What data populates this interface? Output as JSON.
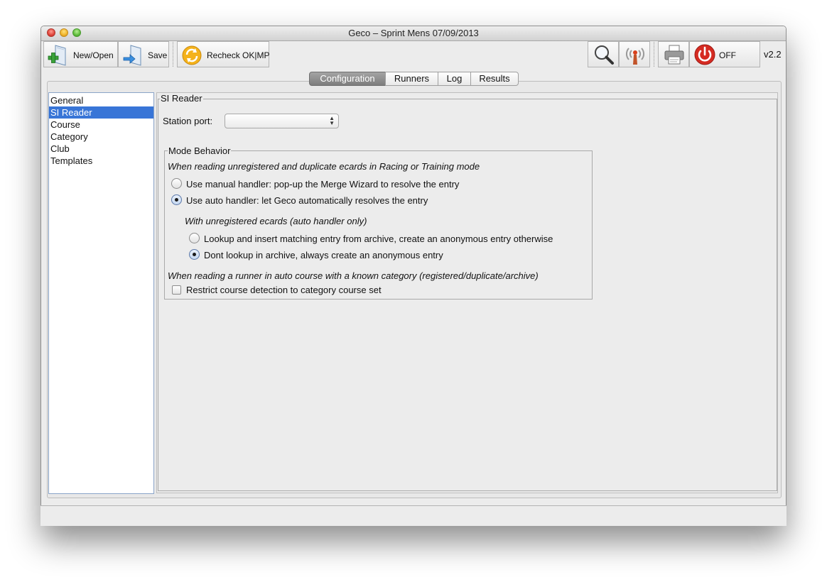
{
  "window": {
    "title": "Geco – Sprint Mens 07/09/2013"
  },
  "toolbar": {
    "new_open_label": "New/Open",
    "save_label": "Save",
    "recheck_label": "Recheck OK|MP",
    "off_label": "OFF",
    "version": "v2.2",
    "icons": [
      "new-file-icon",
      "save-file-icon",
      "recheck-icon",
      "magnifier-icon",
      "antenna-icon",
      "printer-icon",
      "power-icon"
    ]
  },
  "tabs": [
    {
      "label": "Configuration",
      "active": true
    },
    {
      "label": "Runners",
      "active": false
    },
    {
      "label": "Log",
      "active": false
    },
    {
      "label": "Results",
      "active": false
    }
  ],
  "sidebar": {
    "items": [
      {
        "label": "General",
        "selected": false
      },
      {
        "label": "SI Reader",
        "selected": true
      },
      {
        "label": "Course",
        "selected": false
      },
      {
        "label": "Category",
        "selected": false
      },
      {
        "label": "Club",
        "selected": false
      },
      {
        "label": "Templates",
        "selected": false
      }
    ]
  },
  "si_reader": {
    "section_title": "SI Reader",
    "station_port_label": "Station port:",
    "station_port_value": "",
    "mode_behavior": {
      "title": "Mode Behavior",
      "intro": "When reading unregistered and duplicate ecards in Racing or Training mode",
      "manual_handler": {
        "label": "Use manual handler: pop-up the Merge Wizard to resolve the entry",
        "checked": false
      },
      "auto_handler": {
        "label": "Use auto handler: let Geco automatically resolves the entry",
        "checked": true
      },
      "unregistered_intro": "With unregistered ecards (auto handler only)",
      "lookup_archive": {
        "label": "Lookup and insert matching entry from archive, create an anonymous entry otherwise",
        "checked": false
      },
      "dont_lookup": {
        "label": "Dont lookup in archive, always create an anonymous entry",
        "checked": true
      },
      "auto_course_intro": "When reading a runner in auto course with a known category (registered/duplicate/archive)",
      "restrict_course": {
        "label": "Restrict course detection to category course set",
        "checked": false
      }
    }
  }
}
